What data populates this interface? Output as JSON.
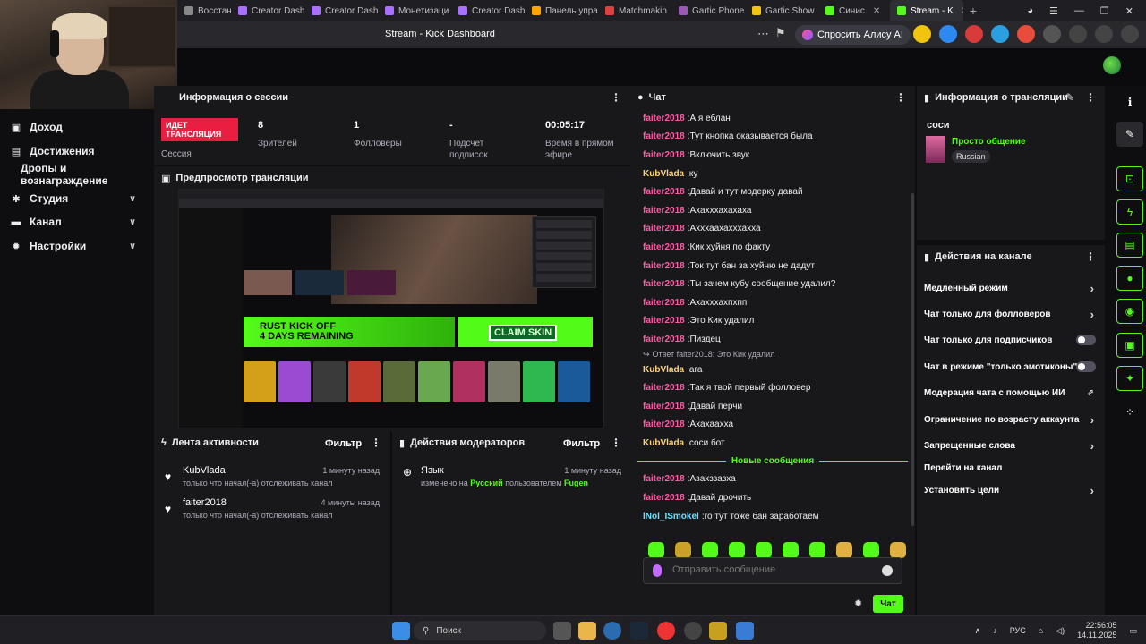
{
  "browser": {
    "tabs": [
      {
        "label": "Восстановл",
        "color": "#888"
      },
      {
        "label": "Creator Dash",
        "color": "#a970ff"
      },
      {
        "label": "Creator Dash",
        "color": "#a970ff"
      },
      {
        "label": "Монетизаци",
        "color": "#a970ff"
      },
      {
        "label": "Creator Dash",
        "color": "#a970ff"
      },
      {
        "label": "Панель упра",
        "color": "#ffa500"
      },
      {
        "label": "Matchmakin",
        "color": "#e04040"
      },
      {
        "label": "Gartic Phone",
        "color": "#9b59b6"
      },
      {
        "label": "Gartic Show",
        "color": "#f1c40f"
      },
      {
        "label": "Синис",
        "color": "#53fc18"
      },
      {
        "label": "Stream - K",
        "color": "#53fc18"
      }
    ],
    "page_title": "Stream - Kick Dashboard",
    "alice_label": "Спросить Алису AI"
  },
  "nav": {
    "items": [
      {
        "label": "Доход",
        "icon": "money-icon"
      },
      {
        "label": "Достижения",
        "icon": "trophy-icon"
      },
      {
        "label": "Дропы и вознаграждение",
        "icon": ""
      },
      {
        "label": "Студия",
        "icon": "studio-icon"
      },
      {
        "label": "Канал",
        "icon": "channel-icon"
      },
      {
        "label": "Настройки",
        "icon": "gear-icon"
      }
    ]
  },
  "session": {
    "title": "Информация о сессии",
    "live_badge": "ИДЕТ ТРАНСЛЯЦИЯ",
    "live_label": "Сессия",
    "stats": [
      {
        "value": "8",
        "label": "Зрителей"
      },
      {
        "value": "1",
        "label": "Фолловеры"
      },
      {
        "value": "-",
        "label": "Подсчет подписок"
      },
      {
        "value": "00:05:17",
        "label": "Время в прямом эфире"
      }
    ]
  },
  "preview": {
    "title": "Предпросмотр трансляции",
    "banner1": "RUST KICK OFF\n4 DAYS REMAINING",
    "banner2": "CLAIM SKIN"
  },
  "activity": {
    "title": "Лента активности",
    "filter": "Фильтр",
    "items": [
      {
        "name": "KubVlada",
        "time": "1 минуту назад",
        "desc": "только что начал(-а) отслеживать канал"
      },
      {
        "name": "faiter2018",
        "time": "4 минуты назад",
        "desc": "только что начал(-а) отслеживать канал"
      }
    ]
  },
  "modactions": {
    "title": "Действия модераторов",
    "filter": "Фильтр",
    "item": {
      "name": "Язык",
      "time": "1 минуту назад",
      "pre": "изменено на",
      "lang": "Русский",
      "mid": "пользователем",
      "user": "Fugen"
    }
  },
  "chat": {
    "title": "Чат",
    "messages": [
      {
        "user": "faiter2018",
        "color": "#ff5aa5",
        "text": "А я еблан"
      },
      {
        "user": "faiter2018",
        "color": "#ff5aa5",
        "text": "Тут кнопка оказывается была"
      },
      {
        "user": "faiter2018",
        "color": "#ff5aa5",
        "text": "Включить звук"
      },
      {
        "user": "KubVlada",
        "color": "#ffd27a",
        "text": "ку"
      },
      {
        "user": "faiter2018",
        "color": "#ff5aa5",
        "text": "Давай и тут модерку давай"
      },
      {
        "user": "faiter2018",
        "color": "#ff5aa5",
        "text": "Ахахххахахаха"
      },
      {
        "user": "faiter2018",
        "color": "#ff5aa5",
        "text": "Ахххаахахххахха"
      },
      {
        "user": "faiter2018",
        "color": "#ff5aa5",
        "text": "Кик хуйня по факту"
      },
      {
        "user": "faiter2018",
        "color": "#ff5aa5",
        "text": "Ток тут бан за хуйню не дадут"
      },
      {
        "user": "faiter2018",
        "color": "#ff5aa5",
        "text": "Ты зачем кубу сообщение удалил?"
      },
      {
        "user": "faiter2018",
        "color": "#ff5aa5",
        "text": "Ахахххахпхпп"
      },
      {
        "user": "faiter2018",
        "color": "#ff5aa5",
        "text": "Это Кик удалил"
      },
      {
        "user": "faiter2018",
        "color": "#ff5aa5",
        "text": "Пиздец"
      }
    ],
    "reply_line": "Ответ faiter2018: Это Кик удалил",
    "messages2": [
      {
        "user": "KubVlada",
        "color": "#ffd27a",
        "text": "ага"
      },
      {
        "user": "faiter2018",
        "color": "#ff5aa5",
        "text": "Так я твой первый фолловер"
      },
      {
        "user": "faiter2018",
        "color": "#ff5aa5",
        "text": "Давай перчи"
      },
      {
        "user": "faiter2018",
        "color": "#ff5aa5",
        "text": "Ахахаахха"
      },
      {
        "user": "KubVlada",
        "color": "#ffd27a",
        "text": "соси бот"
      }
    ],
    "new_messages": "Новые сообщения",
    "messages3": [
      {
        "user": "faiter2018",
        "color": "#ff5aa5",
        "text": "Азахззазха"
      },
      {
        "user": "faiter2018",
        "color": "#ff5aa5",
        "text": "Давай дрочить"
      },
      {
        "user": "lNol_ISmokel",
        "color": "#6ee0ff",
        "text": "го тут тоже бан заработаем"
      }
    ],
    "placeholder": "Отправить сообщение",
    "send": "Чат"
  },
  "streaminfo": {
    "title": "Информация о трансляции",
    "stream_title": "соси",
    "category": "Просто общение",
    "language": "Russian"
  },
  "channel_actions": {
    "title": "Действия на канале",
    "items": [
      {
        "label": "Медленный режим",
        "ctrl": "chevron"
      },
      {
        "label": "Чат только для фолловеров",
        "ctrl": "chevron"
      },
      {
        "label": "Чат только для подписчиков",
        "ctrl": "toggle"
      },
      {
        "label": "Чат в режиме \"только эмотиконы\"",
        "ctrl": "toggle"
      },
      {
        "label": "Модерация чата с помощью ИИ",
        "ctrl": "external"
      },
      {
        "label": "Ограничение по возрасту аккаунта",
        "ctrl": "chevron"
      },
      {
        "label": "Запрещенные слова",
        "ctrl": "chevron"
      },
      {
        "label": "Перейти на канал",
        "ctrl": "none"
      },
      {
        "label": "Установить цели",
        "ctrl": "chevron"
      }
    ]
  },
  "taskbar": {
    "search": "Поиск",
    "lang": "РУС",
    "time": "22:56:05",
    "date": "14.11.2025"
  },
  "colors": {
    "accent": "#53fc18",
    "live": "#e91e41",
    "panel": "#18181b",
    "bg": "#0e0e10"
  }
}
